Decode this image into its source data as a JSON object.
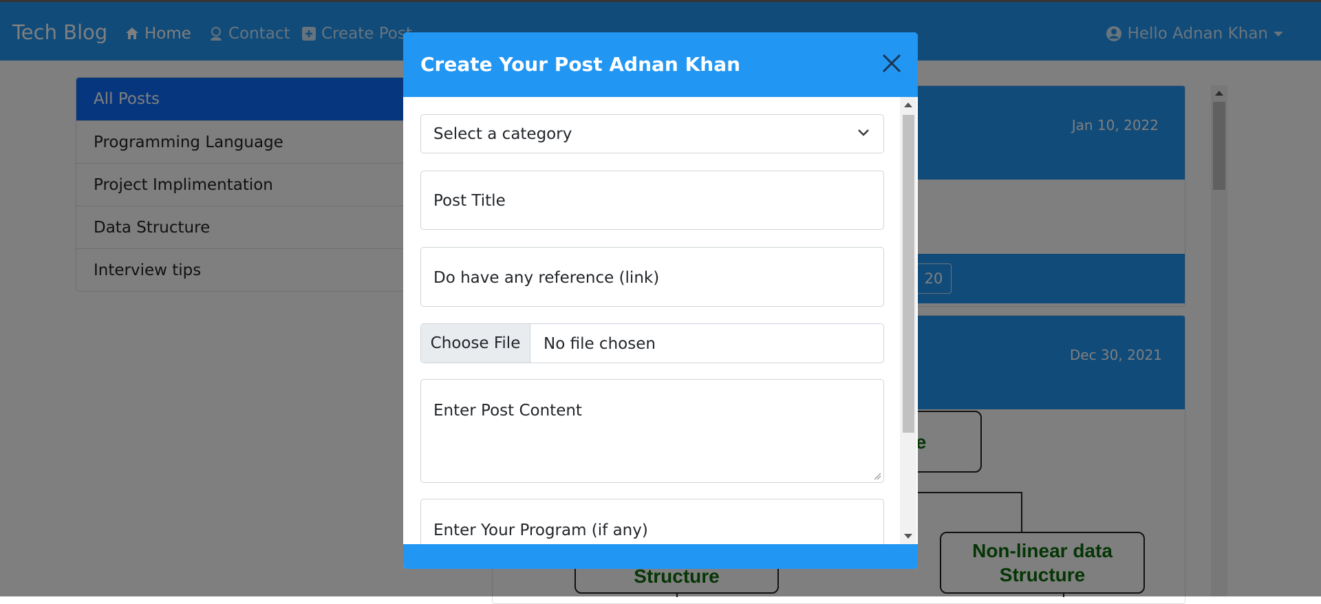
{
  "navbar": {
    "brand": "Tech Blog",
    "links": [
      {
        "label": "Home",
        "icon": "home-icon"
      },
      {
        "label": "Contact",
        "icon": "contact-icon"
      },
      {
        "label": "Create Post",
        "icon": "plus-square-icon"
      }
    ],
    "user": {
      "label": "Hello Adnan Khan",
      "icon": "user-circle-icon"
    }
  },
  "sidebar": {
    "items": [
      {
        "label": "All Posts",
        "active": true
      },
      {
        "label": "Programming Language"
      },
      {
        "label": "Project Implimentation"
      },
      {
        "label": "Data Structure"
      },
      {
        "label": "Interview tips"
      }
    ]
  },
  "posts": [
    {
      "date": "Jan 10, 2022",
      "footer_button": "20"
    },
    {
      "date": "Dec 30, 2021"
    }
  ],
  "diagram": {
    "boxes": [
      {
        "text": "e"
      },
      {
        "text": "Structure"
      },
      {
        "text": "Non-linear data Structure"
      }
    ]
  },
  "modal": {
    "title": "Create Your Post Adnan Khan",
    "close_icon": "close-icon",
    "category_select": {
      "selected": "Select a category"
    },
    "post_title": {
      "placeholder": "Post Title"
    },
    "reference": {
      "placeholder": "Do have any reference (link)"
    },
    "file": {
      "button": "Choose File",
      "status": "No file chosen"
    },
    "content": {
      "placeholder": "Enter Post Content"
    },
    "program": {
      "placeholder": "Enter Your Program (if any)"
    }
  },
  "colors": {
    "primary": "#2196f3",
    "active_item": "#0d6efd",
    "diagram_text": "#0a6b0a",
    "backdrop": "rgba(0,0,0,0.5)"
  }
}
